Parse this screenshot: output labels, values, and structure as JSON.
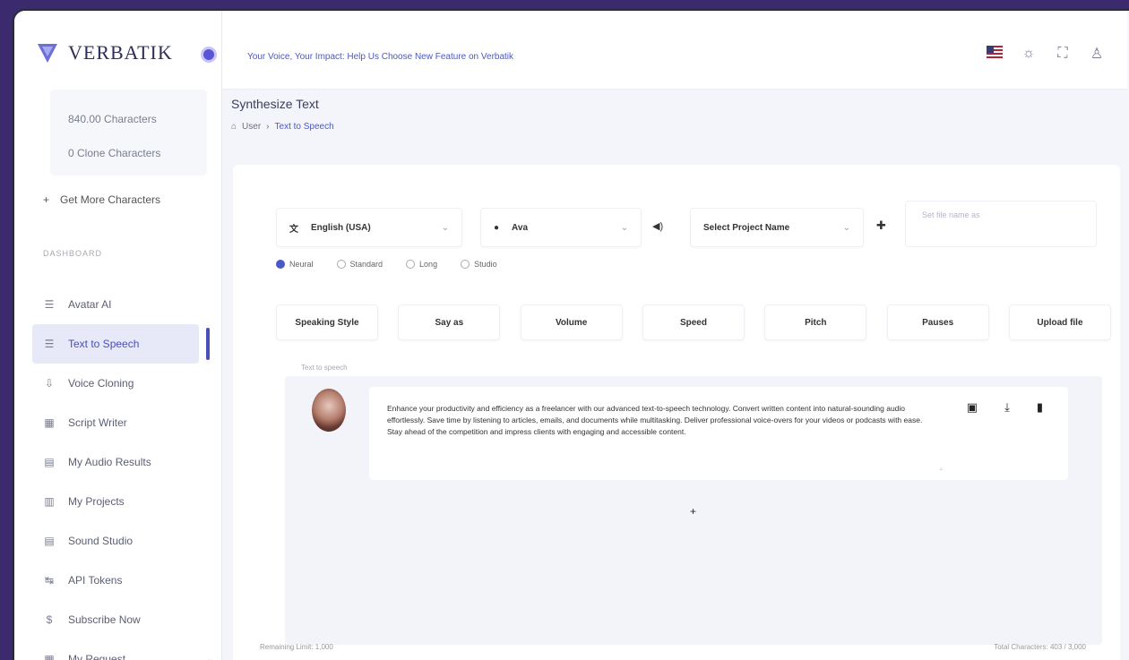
{
  "app": {
    "brand": "VERBATIK"
  },
  "sidebar": {
    "characters": [
      "840.00 Characters",
      "0 Clone Characters"
    ],
    "get_more": "Get More Characters",
    "section_label": "DASHBOARD",
    "items": [
      {
        "label": "Avatar AI",
        "icon": "robot-icon",
        "glyph": "☰",
        "active": false
      },
      {
        "label": "Text to Speech",
        "icon": "text-icon",
        "glyph": "☰",
        "active": true
      },
      {
        "label": "Voice Cloning",
        "icon": "mic-icon",
        "glyph": "⇩",
        "active": false
      },
      {
        "label": "Script Writer",
        "icon": "pen-icon",
        "glyph": "▦",
        "active": false
      },
      {
        "label": "My Audio Results",
        "icon": "audio-icon",
        "glyph": "▤",
        "active": false
      },
      {
        "label": "My Projects",
        "icon": "folder-icon",
        "glyph": "▥",
        "active": false
      },
      {
        "label": "Sound Studio",
        "icon": "studio-icon",
        "glyph": "▤",
        "active": false
      },
      {
        "label": "API Tokens",
        "icon": "key-icon",
        "glyph": "↹",
        "active": false
      },
      {
        "label": "Subscribe Now",
        "icon": "dollar-icon",
        "glyph": "$",
        "active": false
      },
      {
        "label": "My Request",
        "icon": "request-icon",
        "glyph": "▦",
        "active": false
      }
    ]
  },
  "topbar": {
    "announcement": "Your Voice, Your Impact: Help Us Choose New Feature on Verbatik"
  },
  "page": {
    "title": "Synthesize Text",
    "breadcrumb": [
      "User",
      "Text to Speech"
    ]
  },
  "controls": {
    "language": "English (USA)",
    "voice": "Ava",
    "project": "Select Project Name",
    "file_placeholder": "Set file name as"
  },
  "engines": [
    {
      "label": "Neural",
      "on": true
    },
    {
      "label": "Standard",
      "on": false
    },
    {
      "label": "Long",
      "on": false
    },
    {
      "label": "Studio",
      "on": false
    }
  ],
  "params": [
    "Speaking Style",
    "Say as",
    "Volume",
    "Speed",
    "Pitch",
    "Pauses",
    "Upload file"
  ],
  "editor": {
    "label": "Text to speech",
    "text": "Enhance your productivity and efficiency as a freelancer with our advanced text-to-speech technology. Convert written content into natural-sounding audio effortlessly. Save time by listening to articles, emails, and documents while multitasking. Deliver professional voice-overs for your videos or podcasts with ease. Stay ahead of the competition and impress clients with engaging and accessible content.",
    "add_block": "+"
  },
  "footer": {
    "left": "Remaining Limit: 1,000",
    "right": "Total Characters: 403 / 3,000"
  }
}
